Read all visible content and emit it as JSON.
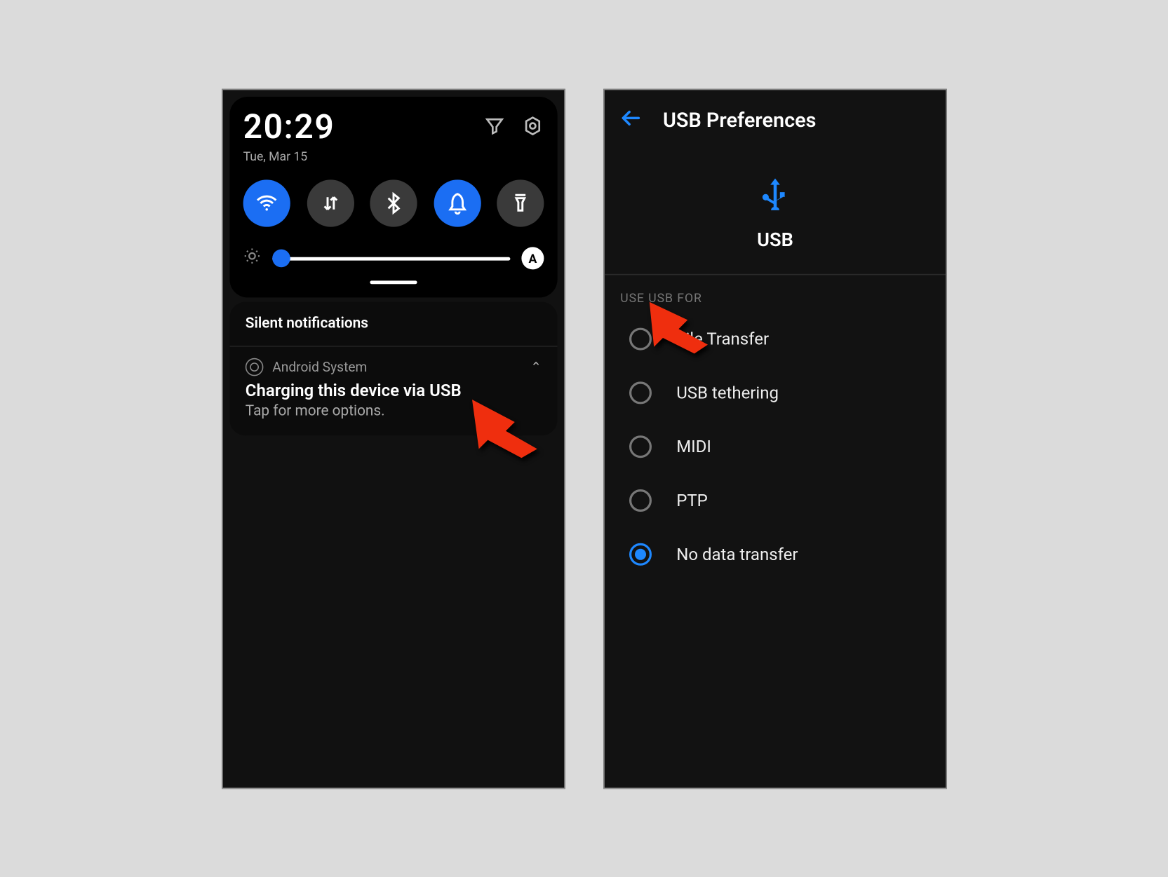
{
  "left": {
    "clock": "20:29",
    "date": "Tue, Mar 15",
    "silent_header": "Silent notifications",
    "notification": {
      "app": "Android System",
      "title": "Charging this device via USB",
      "subtitle": "Tap for more options."
    },
    "qs": {
      "wifi_active": true,
      "data_active": false,
      "bluetooth_active": false,
      "dnd_active": true,
      "torch_active": false
    },
    "brightness": {
      "auto_label": "A",
      "value_pct": 4
    }
  },
  "right": {
    "title": "USB Preferences",
    "hero_label": "USB",
    "section": "USE USB FOR",
    "options": [
      {
        "label": "File Transfer",
        "checked": false
      },
      {
        "label": "USB tethering",
        "checked": false
      },
      {
        "label": "MIDI",
        "checked": false
      },
      {
        "label": "PTP",
        "checked": false
      },
      {
        "label": "No data transfer",
        "checked": true
      }
    ]
  }
}
